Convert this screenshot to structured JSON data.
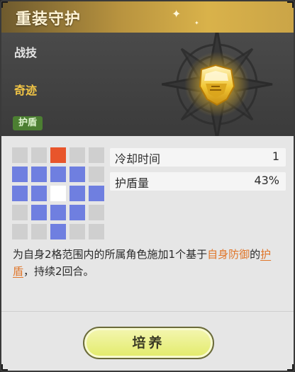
{
  "header": {
    "title": "重装守护"
  },
  "skill": {
    "type": "战技",
    "rarity": "奇迹",
    "tag": "护盾",
    "icon": "golden-shield-icon"
  },
  "range_grid": {
    "rows": [
      [
        "empty",
        "empty",
        "target",
        "empty",
        "empty"
      ],
      [
        "blue",
        "blue",
        "blue",
        "blue",
        "empty"
      ],
      [
        "blue",
        "blue",
        "self",
        "blue",
        "blue"
      ],
      [
        "empty",
        "blue",
        "blue",
        "blue",
        "empty"
      ],
      [
        "empty",
        "empty",
        "blue",
        "empty",
        "empty"
      ]
    ],
    "colors": {
      "empty": "#cfcfcf",
      "blue": "#6f7fe0",
      "self": "#ffffff",
      "target": "#e8552b"
    }
  },
  "stats": [
    {
      "label": "冷却时间",
      "value": "1"
    },
    {
      "label": "护盾量",
      "value": "43%"
    }
  ],
  "description": {
    "part1": "为自身2格范围内的所属角色施加1个基于",
    "highlight1": "自身防御",
    "part2": "的",
    "highlight2": "护盾",
    "part3": "，持续2回合。"
  },
  "actions": {
    "cultivate_label": "培养"
  }
}
